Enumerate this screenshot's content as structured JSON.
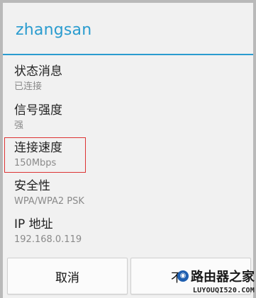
{
  "dialog": {
    "title": "zhangsan",
    "rows": [
      {
        "label": "状态消息",
        "value": "已连接"
      },
      {
        "label": "信号强度",
        "value": "强"
      },
      {
        "label": "连接速度",
        "value": "150Mbps"
      },
      {
        "label": "安全性",
        "value": "WPA/WPA2 PSK"
      },
      {
        "label": "IP 地址",
        "value": "192.168.0.119"
      }
    ],
    "buttons": {
      "cancel": "取消",
      "forget": "不"
    }
  },
  "watermark": {
    "logo": "路由器之家",
    "url": "LUYOUQI520.COM"
  },
  "colors": {
    "accent": "#2a9ccf",
    "highlight": "#dd3333"
  }
}
